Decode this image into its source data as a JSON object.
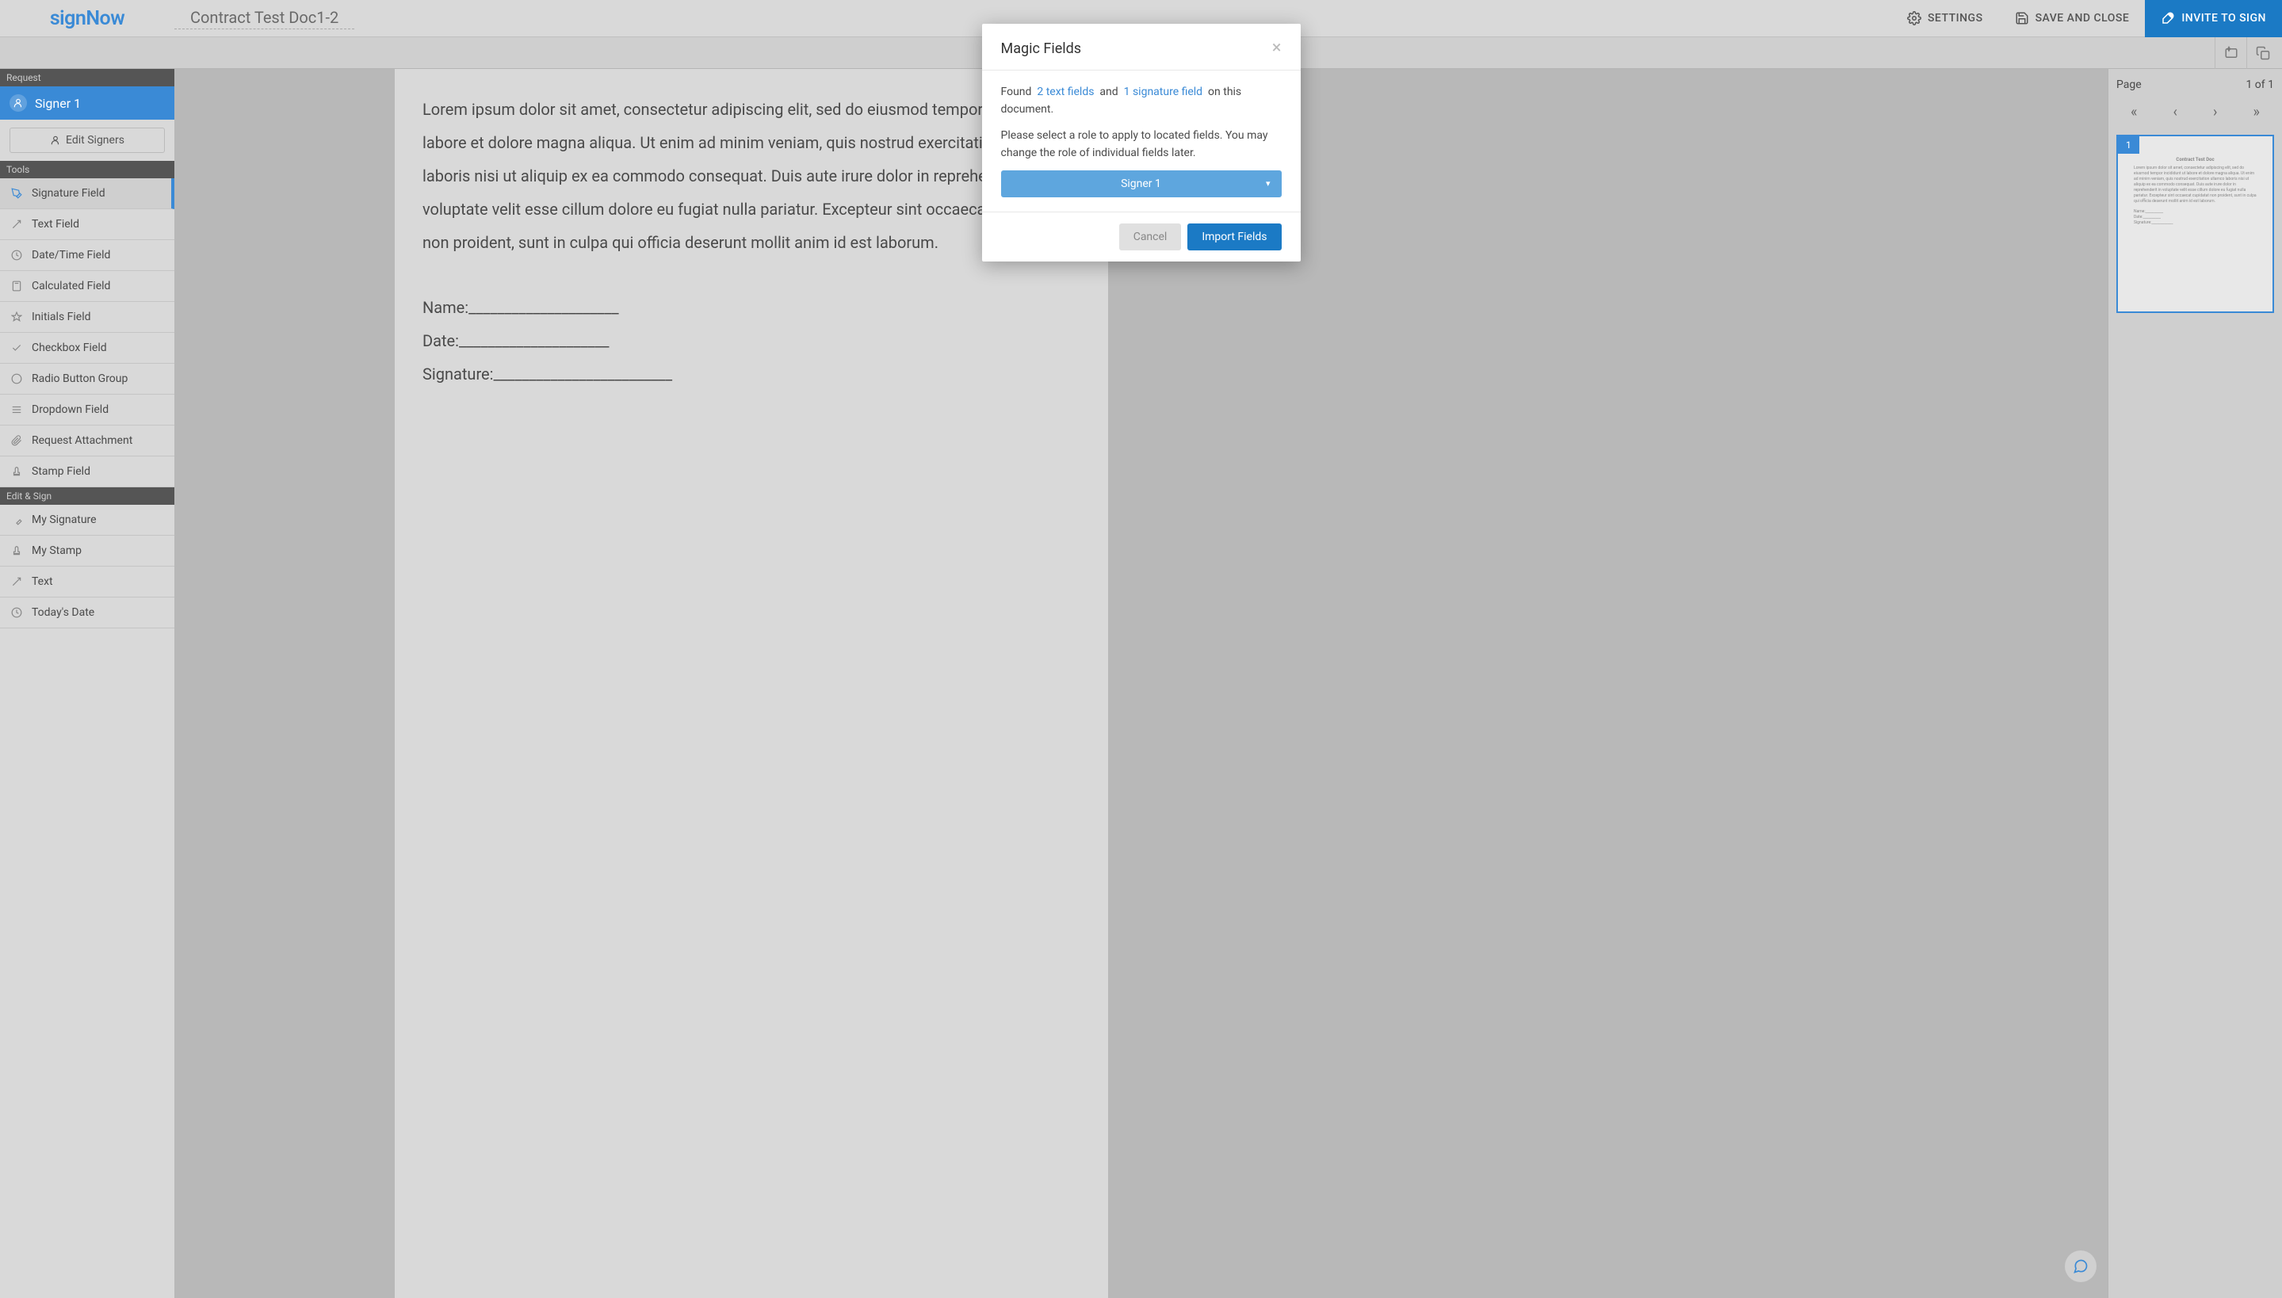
{
  "logo": "signNow",
  "doc_title": "Contract Test Doc1-2",
  "header": {
    "settings": "SETTINGS",
    "save_close": "SAVE AND CLOSE",
    "invite": "INVITE TO SIGN"
  },
  "sidebar": {
    "request_header": "Request",
    "signer_name": "Signer 1",
    "edit_signers": "Edit Signers",
    "tools_header": "Tools",
    "tools": [
      "Signature Field",
      "Text Field",
      "Date/Time Field",
      "Calculated Field",
      "Initials Field",
      "Checkbox Field",
      "Radio Button Group",
      "Dropdown Field",
      "Request Attachment",
      "Stamp Field"
    ],
    "edit_sign_header": "Edit & Sign",
    "edit_sign": [
      "My Signature",
      "My Stamp",
      "Text",
      "Today's Date"
    ]
  },
  "document": {
    "paragraph": "Lorem ipsum dolor sit amet, consectetur adipiscing elit, sed do eiusmod tempor incididunt ut labore et dolore magna aliqua. Ut enim ad minim veniam, quis nostrud exercitation ullamco laboris nisi ut aliquip ex ea commodo consequat. Duis aute irure dolor in reprehenderit in voluptate velit esse cillum dolore eu fugiat nulla pariatur. Excepteur sint occaecat cupidatat non proident, sunt in culpa qui officia deserunt mollit anim id est laborum.",
    "name_label": "Name:_____________________",
    "date_label": "Date:_____________________",
    "signature_label": "Signature:_________________________"
  },
  "right": {
    "page_label": "Page",
    "page_of": "1 of 1",
    "thumb_num": "1"
  },
  "modal": {
    "title": "Magic Fields",
    "found": "Found",
    "text_fields": "2 text fields",
    "and": "and",
    "sig_field": "1 signature field",
    "on_doc": "on this document.",
    "instruction": "Please select a role to apply to located fields. You may change the role of individual fields later.",
    "selected_role": "Signer 1",
    "cancel": "Cancel",
    "import": "Import Fields"
  }
}
